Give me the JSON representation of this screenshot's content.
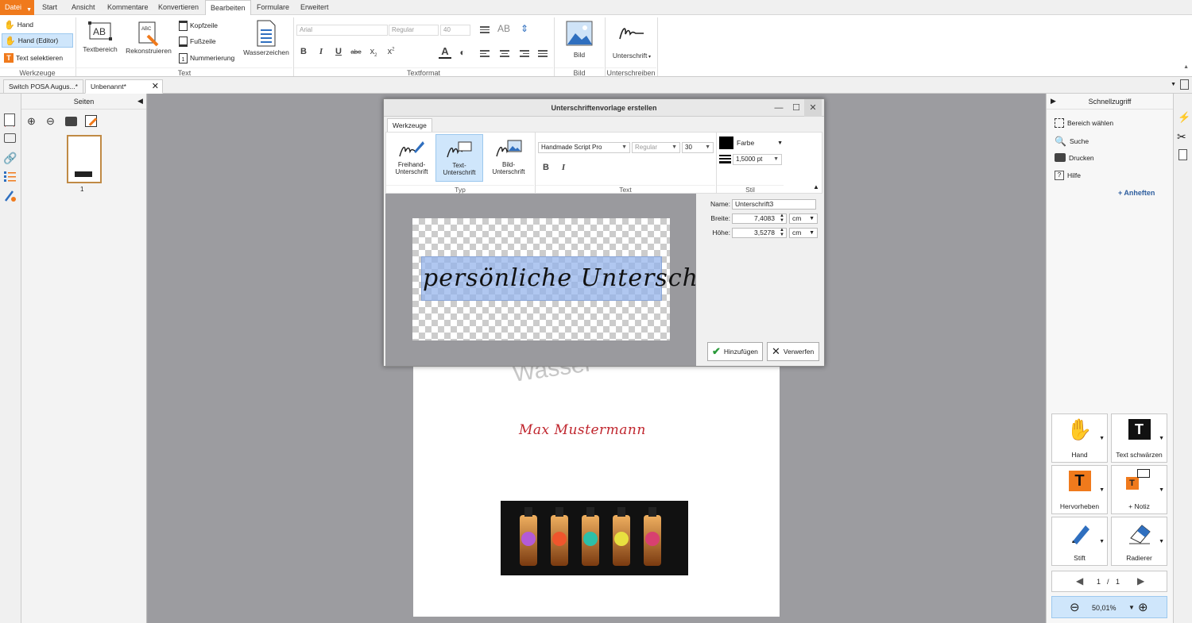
{
  "menubar": {
    "file": "Datei",
    "items": [
      "Start",
      "Ansicht",
      "Kommentare",
      "Konvertieren",
      "Bearbeiten",
      "Formulare",
      "Erweitert"
    ]
  },
  "ribbon": {
    "tools": {
      "hand": "Hand",
      "hand_editor": "Hand (Editor)",
      "select_text": "Text selektieren",
      "label": "Werkzeuge"
    },
    "text": {
      "textbereich": "Textbereich",
      "rekonstruieren": "Rekonstruieren",
      "kopfzeile": "Kopfzeile",
      "fusszeile": "Fußzeile",
      "nummerierung": "Nummerierung",
      "wasserzeichen": "Wasserzeichen",
      "label": "Text"
    },
    "textformat": {
      "font": "Arial",
      "style": "Regular",
      "size": "40",
      "label": "Textformat"
    },
    "bild": {
      "button": "Bild",
      "label": "Bild"
    },
    "sign": {
      "button": "Unterschrift",
      "label": "Unterschreiben"
    }
  },
  "doctabs": [
    "Switch POSA Augus...*",
    "Unbenannt*"
  ],
  "pages_panel": {
    "title": "Seiten",
    "page_number": "1"
  },
  "document": {
    "watermark": "Wasser",
    "signature_name": "Max Mustermann"
  },
  "dialog": {
    "title": "Unterschriftenvorlage erstellen",
    "tab": "Werkzeuge",
    "types": [
      {
        "label_1": "Freihand-",
        "label_2": "Unterschrift"
      },
      {
        "label_1": "Text-",
        "label_2": "Unterschrift"
      },
      {
        "label_1": "Bild-",
        "label_2": "Unterschrift"
      }
    ],
    "section_typ": "Typ",
    "section_text": "Text",
    "section_stil": "Stil",
    "font": "Handmade Script Pro",
    "style": "Regular",
    "size": "30",
    "color_label": "Farbe",
    "line_width": "1,5000 pt",
    "preview_text": "persönliche Unterschrift",
    "props": {
      "name_label": "Name:",
      "name_value": "Unterschrift3",
      "width_label": "Breite:",
      "width_value": "7,4083",
      "width_unit": "cm",
      "height_label": "Höhe:",
      "height_value": "3,5278",
      "height_unit": "cm"
    },
    "add_button": "Hinzufügen",
    "discard_button": "Verwerfen"
  },
  "quick_access": {
    "title": "Schnellzugriff",
    "items": [
      "Bereich wählen",
      "Suche",
      "Drucken",
      "Hilfe"
    ],
    "pin": "+ Anheften",
    "tools": [
      "Hand",
      "Text schwärzen",
      "Hervorheben",
      "+ Notiz",
      "Stift",
      "Radierer"
    ],
    "page_current": "1",
    "page_sep": "/",
    "page_total": "1",
    "zoom": "50,01%"
  },
  "colors": {
    "accent_orange": "#f07a1c",
    "selection_blue": "#cfe6fb",
    "signature_red": "#c0262e",
    "icon_blue": "#2f6fbf"
  }
}
